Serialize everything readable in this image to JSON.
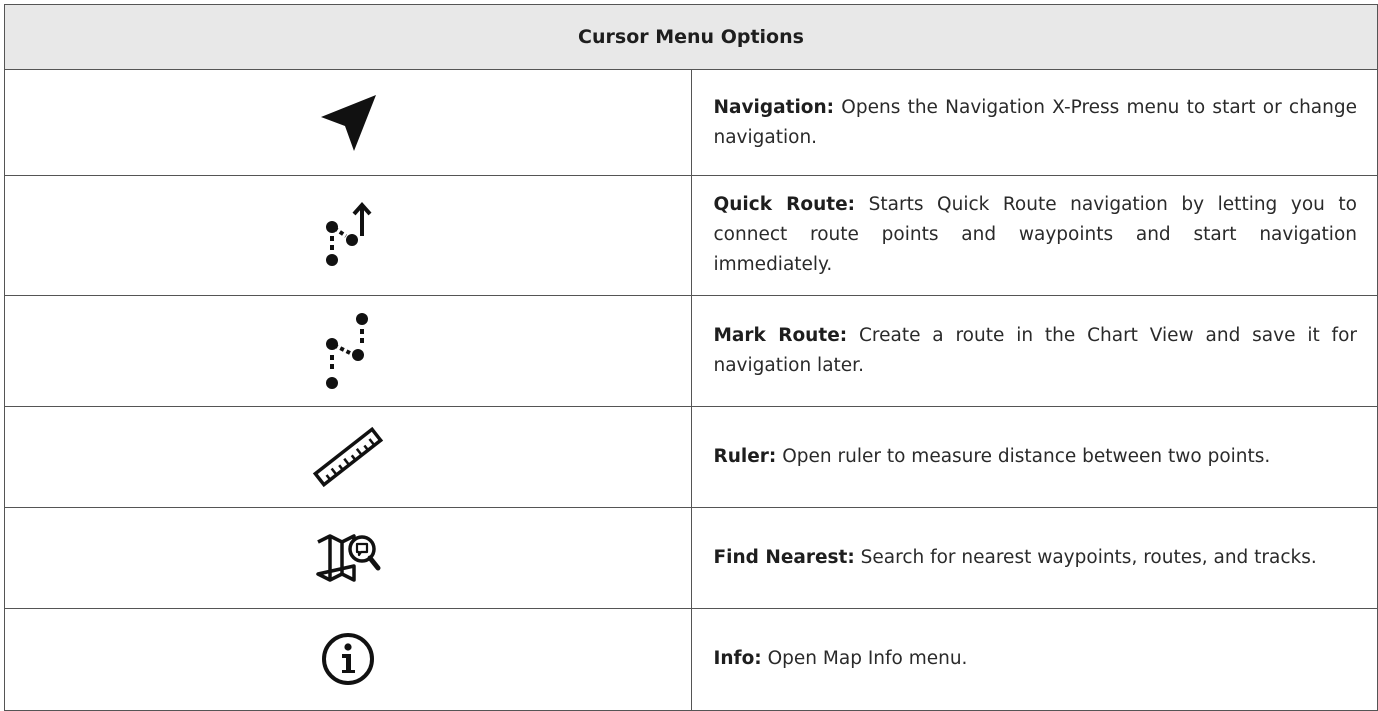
{
  "table": {
    "header": "Cursor Menu Options",
    "rows": [
      {
        "icon": "navigation-arrow-icon",
        "term": "Navigation:",
        "text": " Opens the Navigation X-Press menu to start or change navigation."
      },
      {
        "icon": "quick-route-icon",
        "term": "Quick Route:",
        "text": " Starts Quick Route navigation by letting you to connect route points and waypoints and start navigation immediately."
      },
      {
        "icon": "mark-route-icon",
        "term": "Mark Route:",
        "text": " Create a route in the Chart View and save it for navigation later."
      },
      {
        "icon": "ruler-icon",
        "term": "Ruler:",
        "text": " Open ruler to measure distance between two points."
      },
      {
        "icon": "find-nearest-map-icon",
        "term": "Find Nearest:",
        "text": " Search for nearest waypoints, routes, and tracks."
      },
      {
        "icon": "info-icon",
        "term": "Info:",
        "text": " Open Map Info menu."
      }
    ]
  }
}
